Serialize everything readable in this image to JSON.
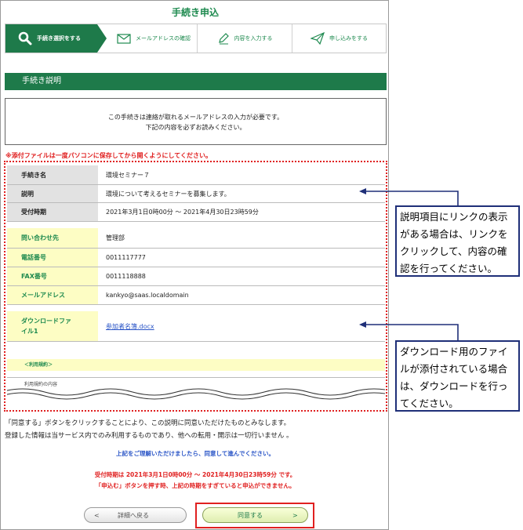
{
  "page": {
    "title": "手続き申込"
  },
  "steps": [
    {
      "label": "手続き選択をする",
      "icon": "magnifier-icon"
    },
    {
      "label": "メールアドレスの確認",
      "icon": "envelope-icon"
    },
    {
      "label": "内容を入力する",
      "icon": "pencil-icon"
    },
    {
      "label": "申し込みをする",
      "icon": "paper-plane-icon"
    }
  ],
  "section": {
    "title": "手続き説明"
  },
  "notice": {
    "line1": "この手続きは連絡が取れるメールアドレスの入力が必要です。",
    "line2": "下記の内容を必ずお読みください。"
  },
  "warning": "※添付ファイルは一度パソコンに保存してから開くようにしてください。",
  "details": {
    "rows": [
      {
        "label": "手続き名",
        "value": "環境セミナー７"
      },
      {
        "label": "説明",
        "value": "環境について考えるセミナーを募集します。"
      },
      {
        "label": "受付時期",
        "value": "2021年3月1日0時00分 ～ 2021年4月30日23時59分"
      }
    ]
  },
  "contact": {
    "rows": [
      {
        "label": "問い合わせ先",
        "value": "管理部"
      },
      {
        "label": "電話番号",
        "value": "0011117777"
      },
      {
        "label": "FAX番号",
        "value": "0011118888"
      },
      {
        "label": "メールアドレス",
        "value": "kankyo@saas.localdomain"
      }
    ]
  },
  "download": {
    "label_line1": "ダウンロードファ",
    "label_line2": "イル1",
    "file": "参加者名簿.docx"
  },
  "terms": {
    "header": "＜利用規約＞",
    "content": "利用規約の内容"
  },
  "agreement": {
    "line1": "「同意する」ボタンをクリックすることにより、この説明に同意いただけたものとみなします。",
    "line2": "登録した情報は当サービス内でのみ利用するものであり、他への転用・開示は一切行いません 。"
  },
  "confirm": {
    "proceed": "上記をご理解いただけましたら、同意して進んでください。",
    "period": "受付時期は 2021年3月1日0時00分 ～ 2021年4月30日23時59分 です。",
    "caution": "「申込む」ボタンを押す時、上記の時期をすぎていると申込ができません。"
  },
  "buttons": {
    "back": {
      "label": "詳細へ戻る",
      "chevron": "<"
    },
    "agree": {
      "label": "同意する",
      "chevron": ">"
    }
  },
  "callouts": {
    "link": {
      "lines": [
        "説明項目にリンクの表示",
        "がある場合は、リンクを",
        "クリックして、内容の確",
        "認を行ってください。"
      ]
    },
    "download": {
      "lines": [
        "ダウンロード用のファイ",
        "ルが添付されている場合",
        "は、ダウンロードを行っ",
        "てください。"
      ]
    }
  },
  "colors": {
    "brand": "#1e7a4a",
    "accent_red": "#e02020",
    "callout_border": "#1f2f78",
    "label_yellow": "#fdfdc4",
    "label_gray": "#e2e2e2"
  }
}
